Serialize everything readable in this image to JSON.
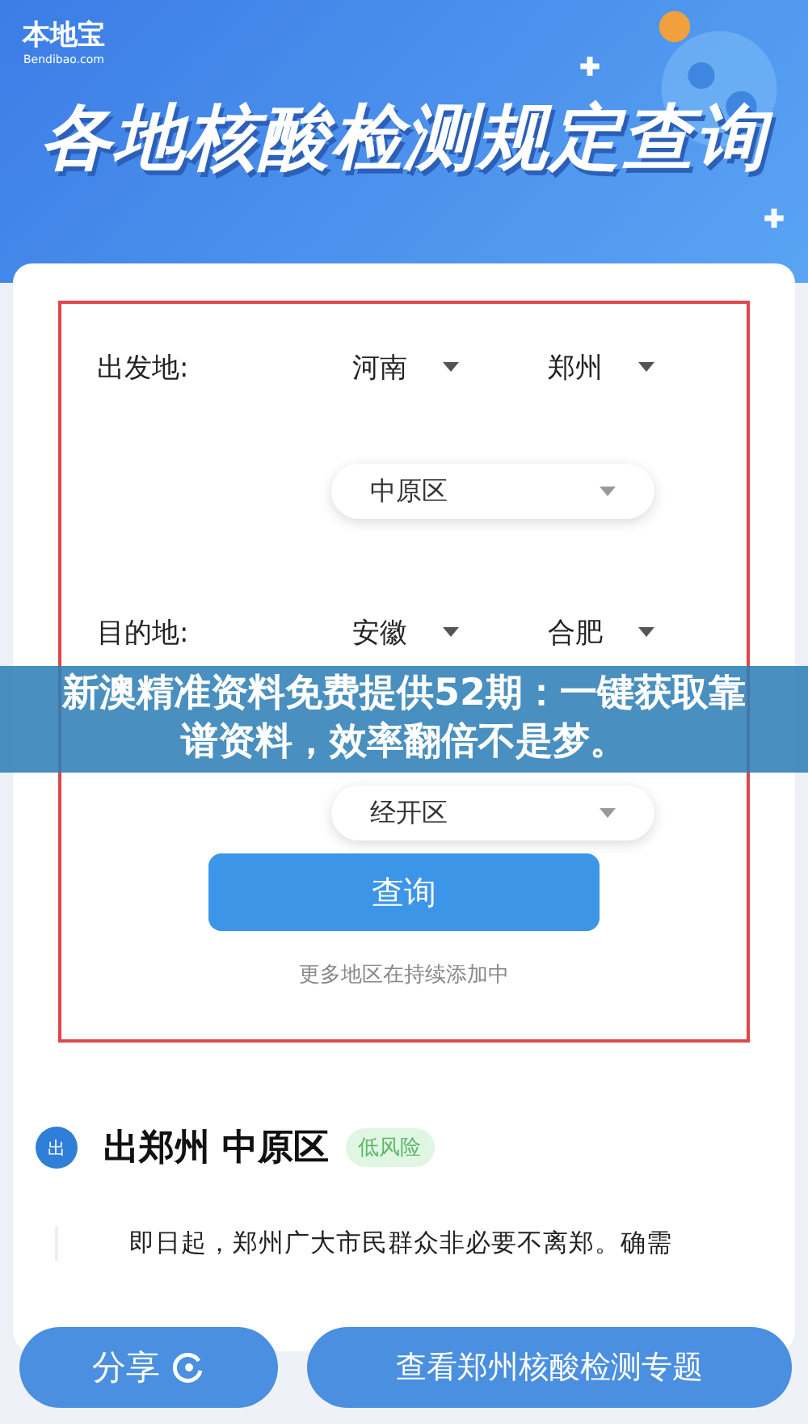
{
  "header": {
    "logo": "本地宝",
    "logo_sub": "Bendibao.com",
    "title": "各地核酸检测规定查询"
  },
  "form": {
    "rows": [
      {
        "label": "出发地:",
        "province": "河南",
        "city": "郑州",
        "district": "中原区"
      },
      {
        "label": "目的地:",
        "province": "安徽",
        "city": "合肥",
        "district": "经开区"
      }
    ],
    "button": "查询",
    "note": "更多地区在持续添加中"
  },
  "result": {
    "badge": "出",
    "title": "出郑州 中原区",
    "risk": "低风险",
    "text": "即日起，郑州广大市民群众非必要不离郑。确需"
  },
  "actions": {
    "share": "分享",
    "topic": "查看郑州核酸检测专题"
  },
  "overlay": {
    "caption": "新澳精准资料免费提供52期：一键获取靠谱资料，效率翻倍不是梦。"
  }
}
